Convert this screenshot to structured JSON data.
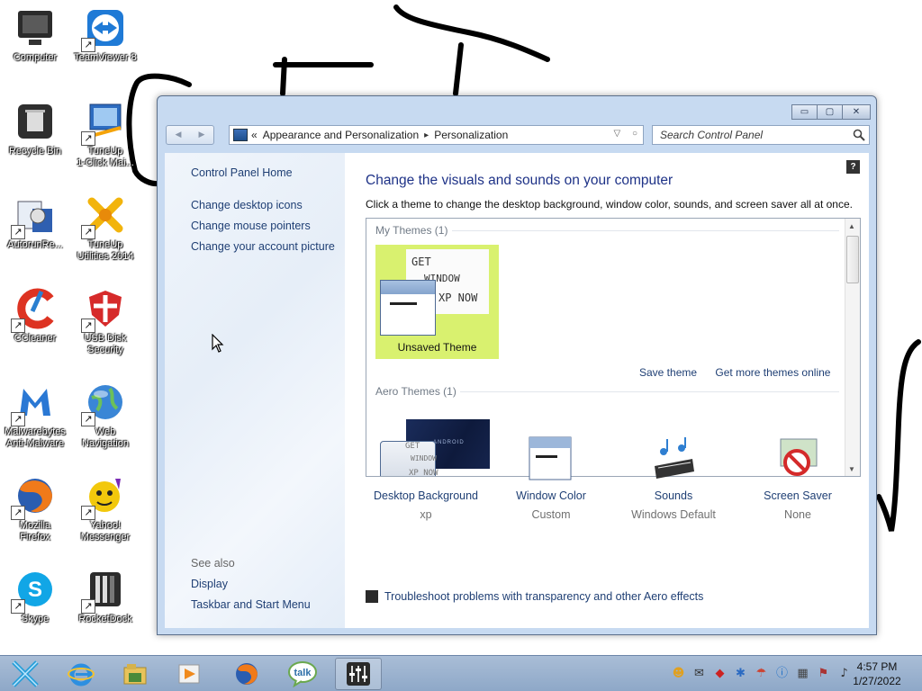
{
  "desktop": {
    "icons": [
      {
        "label": "Computer",
        "icon": "computer-icon"
      },
      {
        "label": "TeamViewer 8",
        "icon": "teamviewer-icon"
      },
      {
        "label": "Recycle Bin",
        "icon": "recycle-bin-icon"
      },
      {
        "label": "TuneUp\n1-Click Mai...",
        "icon": "tuneup-icon"
      },
      {
        "label": "AutorunRe...",
        "icon": "autorun-icon"
      },
      {
        "label": "TuneUp\nUtilities 2014",
        "icon": "tuneup-utilities-icon"
      },
      {
        "label": "CCleaner",
        "icon": "ccleaner-icon"
      },
      {
        "label": "USB Disk\nSecurity",
        "icon": "usb-disk-security-icon"
      },
      {
        "label": "Malwarebytes\nAnti-Malware",
        "icon": "malwarebytes-icon"
      },
      {
        "label": "Web\nNavigation",
        "icon": "globe-icon"
      },
      {
        "label": "Mozilla\nFirefox",
        "icon": "firefox-icon"
      },
      {
        "label": "Yahoo!\nMessenger",
        "icon": "yahoo-messenger-icon"
      },
      {
        "label": "Skype",
        "icon": "skype-icon"
      },
      {
        "label": "RocketDock",
        "icon": "rocketdock-icon"
      }
    ],
    "scribble_text": "GET"
  },
  "window": {
    "caption": {
      "minimize": "▭",
      "maximize": "▢",
      "close": "✕"
    },
    "nav": {
      "back": "◀",
      "forward": "▶"
    },
    "address": {
      "prefix": "«",
      "crumbs": [
        "Appearance and Personalization",
        "Personalization"
      ],
      "sep": "▸",
      "dropdown": "▽",
      "refresh": "○"
    },
    "search_placeholder": "Search Control Panel",
    "help": "?"
  },
  "leftpane": {
    "home": "Control Panel Home",
    "links": [
      "Change desktop icons",
      "Change mouse pointers",
      "Change your account picture"
    ],
    "see_also": "See also",
    "see_also_links": [
      "Display",
      "Taskbar and Start Menu"
    ]
  },
  "main": {
    "title": "Change the visuals and sounds on your computer",
    "subtitle": "Click a theme to change the desktop background, window color, sounds, and screen saver all at once.",
    "my_themes": "My Themes (1)",
    "unsaved_theme": "Unsaved Theme",
    "wallpaper_text": [
      "GET",
      "WINDOW",
      "XP NOW"
    ],
    "save_theme": "Save theme",
    "get_more": "Get more themes online",
    "aero_themes": "Aero Themes (1)",
    "aero_thumb_text": "ANDROID",
    "tile_color": "#d9f16f"
  },
  "bottom": {
    "items": [
      {
        "label": "Desktop Background",
        "value": "xp"
      },
      {
        "label": "Window Color",
        "value": "Custom"
      },
      {
        "label": "Sounds",
        "value": "Windows Default"
      },
      {
        "label": "Screen Saver",
        "value": "None"
      }
    ],
    "troubleshoot": "Troubleshoot problems with transparency and other Aero effects"
  },
  "taskbar": {
    "time": "4:57 PM",
    "date": "1/27/2022",
    "apps": [
      "start-icon",
      "internet-explorer-icon",
      "folder-icon",
      "media-player-icon",
      "firefox-icon",
      "talk-icon",
      "mixer-icon"
    ],
    "talk_label": "talk"
  }
}
